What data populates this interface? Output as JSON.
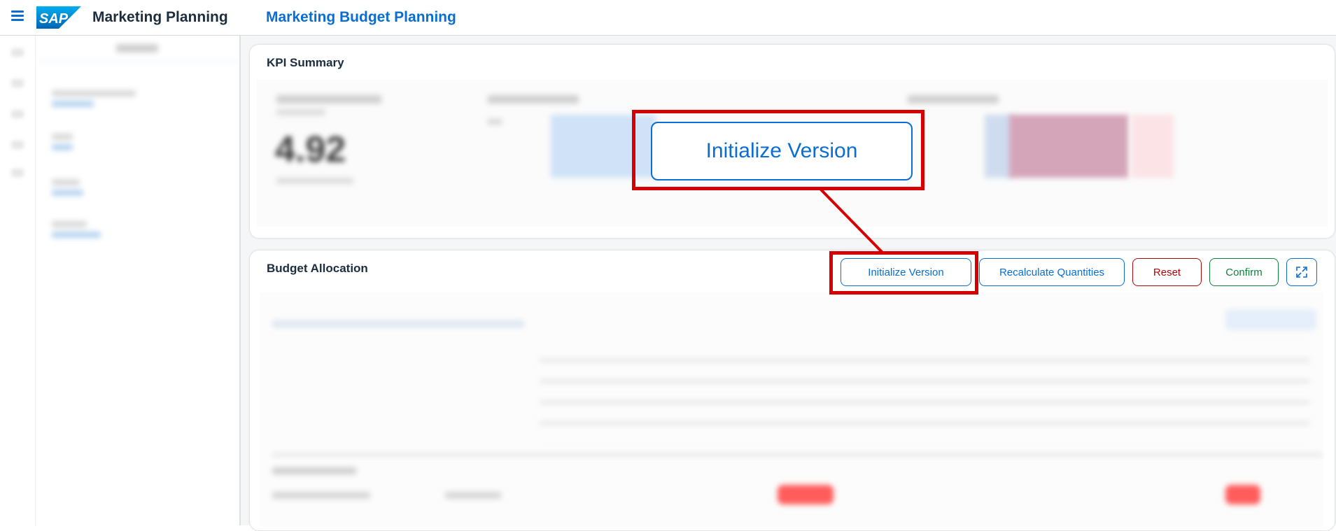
{
  "shell": {
    "app_title": "Marketing Planning",
    "page_title": "Marketing Budget Planning",
    "logo_text": "SAP"
  },
  "kpi": {
    "title": "KPI Summary",
    "blurred_value": "4.92"
  },
  "budget": {
    "title": "Budget Allocation",
    "buttons": {
      "initialize": "Initialize Version",
      "recalculate": "Recalculate Quantities",
      "reset": "Reset",
      "confirm": "Confirm"
    }
  },
  "callout": {
    "label": "Initialize Version"
  },
  "colors": {
    "brand_blue": "#0a6ed1",
    "reject_red": "#aa0808",
    "accept_green": "#107e3e",
    "highlight_red": "#d60000"
  },
  "icons": {
    "menu": "hamburger-icon",
    "fullscreen": "fullscreen-icon"
  }
}
